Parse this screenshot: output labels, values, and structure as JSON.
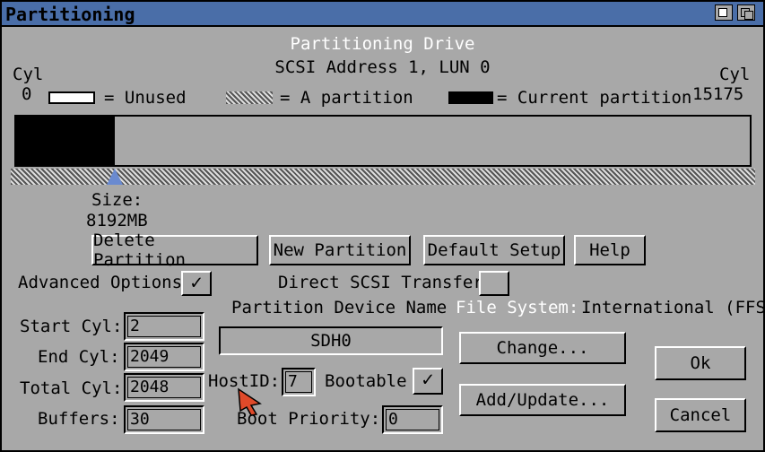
{
  "window": {
    "title": "Partitioning"
  },
  "header": {
    "title": "Partitioning Drive",
    "address": "SCSI Address 1, LUN 0"
  },
  "cylinders": {
    "left_label": "Cyl",
    "left_value": "0",
    "right_label": "Cyl",
    "right_value": "15175"
  },
  "legend": {
    "unused": "= Unused",
    "partition": "= A partition",
    "current": "= Current partition"
  },
  "partition_bar": {
    "current_fraction": 0.135,
    "slider_position_fraction": 0.135
  },
  "size": {
    "label": "Size:",
    "value": "8192MB"
  },
  "buttons": {
    "delete": "Delete Partition",
    "new": "New Partition",
    "default": "Default Setup",
    "help": "Help",
    "change": "Change...",
    "add_update": "Add/Update...",
    "ok": "Ok",
    "cancel": "Cancel"
  },
  "options": {
    "advanced_label": "Advanced Options",
    "advanced_checked": "✓",
    "direct_scsi_label": "Direct SCSI Transfer",
    "direct_scsi_checked": ""
  },
  "device": {
    "label": "Partition Device Name",
    "value": "SDH0"
  },
  "filesystem": {
    "label": "File System:",
    "value": "International (FFS)"
  },
  "fields": {
    "start_cyl_label": "Start Cyl:",
    "start_cyl": "2",
    "end_cyl_label": "End Cyl:",
    "end_cyl": "2049",
    "total_cyl_label": "Total Cyl:",
    "total_cyl": "2048",
    "buffers_label": "Buffers:",
    "buffers": "30",
    "hostid_label": "HostID:",
    "hostid": "7",
    "bootable_label": "Bootable",
    "bootable_checked": "✓",
    "boot_priority_label": "Boot Priority:",
    "boot_priority": "0"
  },
  "colors": {
    "titlebar": "#4a6ea8",
    "background": "#a8a8a8",
    "current_partition": "#000000",
    "slider": "#6a8ad0"
  }
}
